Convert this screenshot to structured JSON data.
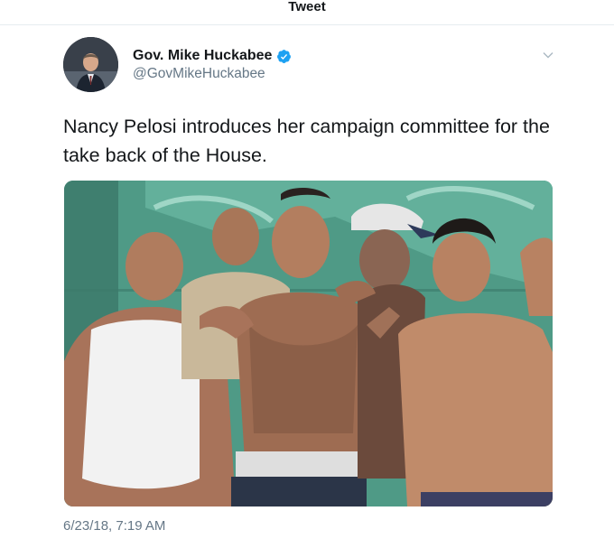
{
  "header": {
    "title": "Tweet"
  },
  "tweet": {
    "author": {
      "name": "Gov. Mike Huckabee",
      "handle": "@GovMikeHuckabee",
      "verified": true,
      "avatar_icon": "profile-photo"
    },
    "text": "Nancy Pelosi introduces her campaign committee for the take back of the House.",
    "media": {
      "type": "photo",
      "icon": "photo"
    },
    "timestamp": "6/23/18, 7:19 AM",
    "menu_icon": "chevron-down-icon"
  },
  "colors": {
    "text_primary": "#14171a",
    "text_secondary": "#657786",
    "verified_blue": "#1da1f2",
    "divider": "#e6ecf0"
  }
}
